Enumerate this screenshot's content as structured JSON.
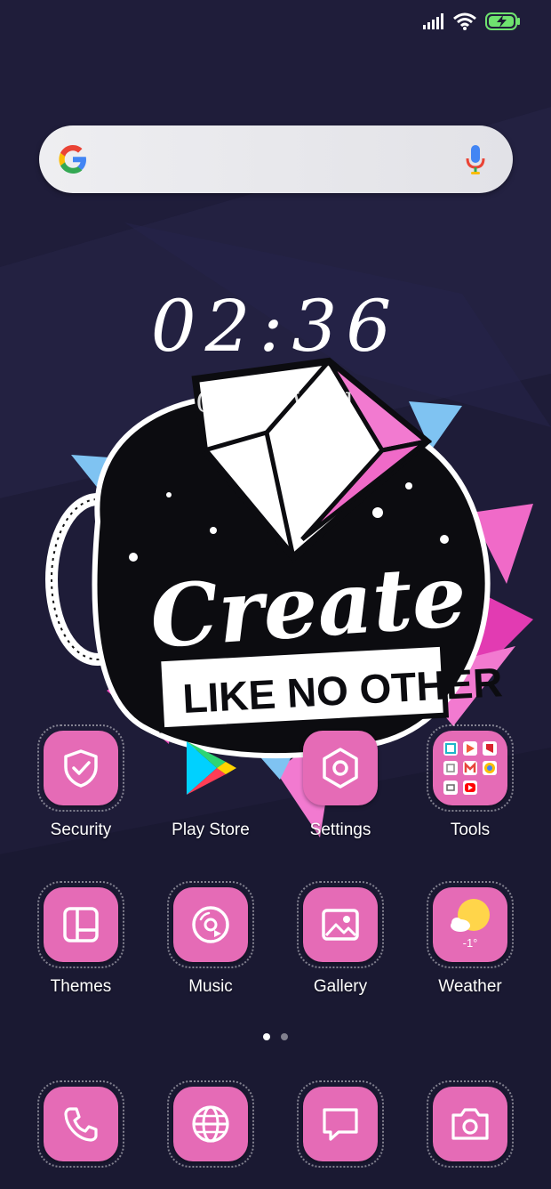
{
  "clock": {
    "time": "02:36",
    "date": "03/04 Wed"
  },
  "wallpaper": {
    "headline": "Create",
    "tagline": "LIKE NO OTHER"
  },
  "apps_row1": [
    {
      "label": "Security",
      "icon": "shield-check-icon"
    },
    {
      "label": "Play Store",
      "icon": "play-store-icon"
    },
    {
      "label": "Settings",
      "icon": "hexagon-settings-icon"
    },
    {
      "label": "Tools",
      "icon": "folder-icon"
    }
  ],
  "apps_row2": [
    {
      "label": "Themes",
      "icon": "themes-icon"
    },
    {
      "label": "Music",
      "icon": "music-disc-icon"
    },
    {
      "label": "Gallery",
      "icon": "image-icon"
    },
    {
      "label": "Weather",
      "icon": "sun-cloud-icon",
      "temp": "-1°"
    }
  ],
  "dock": [
    {
      "icon": "phone-icon"
    },
    {
      "icon": "globe-icon"
    },
    {
      "icon": "message-icon"
    },
    {
      "icon": "camera-icon"
    }
  ],
  "pager": {
    "pages": 2,
    "current": 1
  },
  "colors": {
    "tile": "#e56bb6",
    "background": "#1b1a33",
    "accent_blue": "#7fc3f2"
  }
}
